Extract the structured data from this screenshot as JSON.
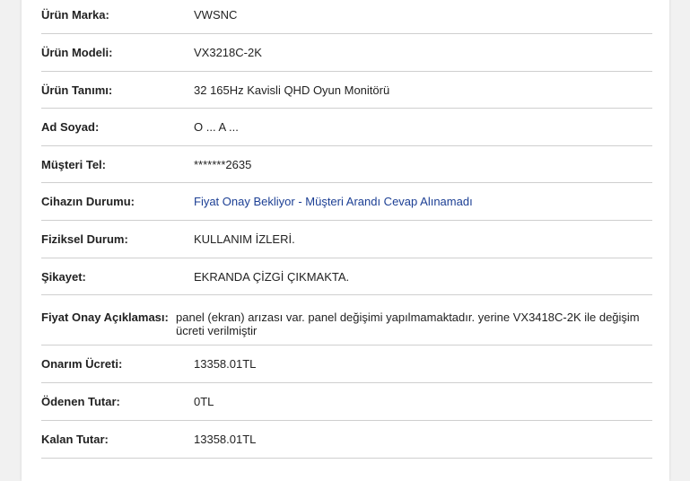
{
  "details": {
    "rows": [
      {
        "label": "Ürün Marka:",
        "value": "VWSNC"
      },
      {
        "label": "Ürün Modeli:",
        "value": "VX3218C-2K"
      },
      {
        "label": "Ürün Tanımı:",
        "value": "32 165Hz Kavisli QHD Oyun Monitörü"
      },
      {
        "label": "Ad Soyad:",
        "value": "O ... A ..."
      },
      {
        "label": "Müşteri Tel:",
        "value": "*******2635"
      },
      {
        "label": "Cihazın Durumu:",
        "value": "Fiyat Onay Bekliyor - Müşteri Arandı Cevap Alınamadı"
      },
      {
        "label": "Fiziksel Durum:",
        "value": "KULLANIM İZLERİ."
      },
      {
        "label": "Şikayet:",
        "value": "EKRANDA ÇİZGİ ÇIKMAKTA."
      },
      {
        "label": "Fiyat Onay Açıklaması:",
        "value": "panel (ekran) arızası var. panel değişimi yapılmamaktadır. yerine VX3418C-2K ile değişim ücreti verilmiştir"
      },
      {
        "label": "Onarım Ücreti:",
        "value": "13358.01TL"
      },
      {
        "label": "Ödenen Tutar:",
        "value": "0TL"
      },
      {
        "label": "Kalan Tutar:",
        "value": "13358.01TL"
      }
    ]
  },
  "colors": {
    "status_text": "#1c3f94",
    "divider": "#cfcfcf",
    "background": "#f1f1f1",
    "card": "#ffffff"
  }
}
